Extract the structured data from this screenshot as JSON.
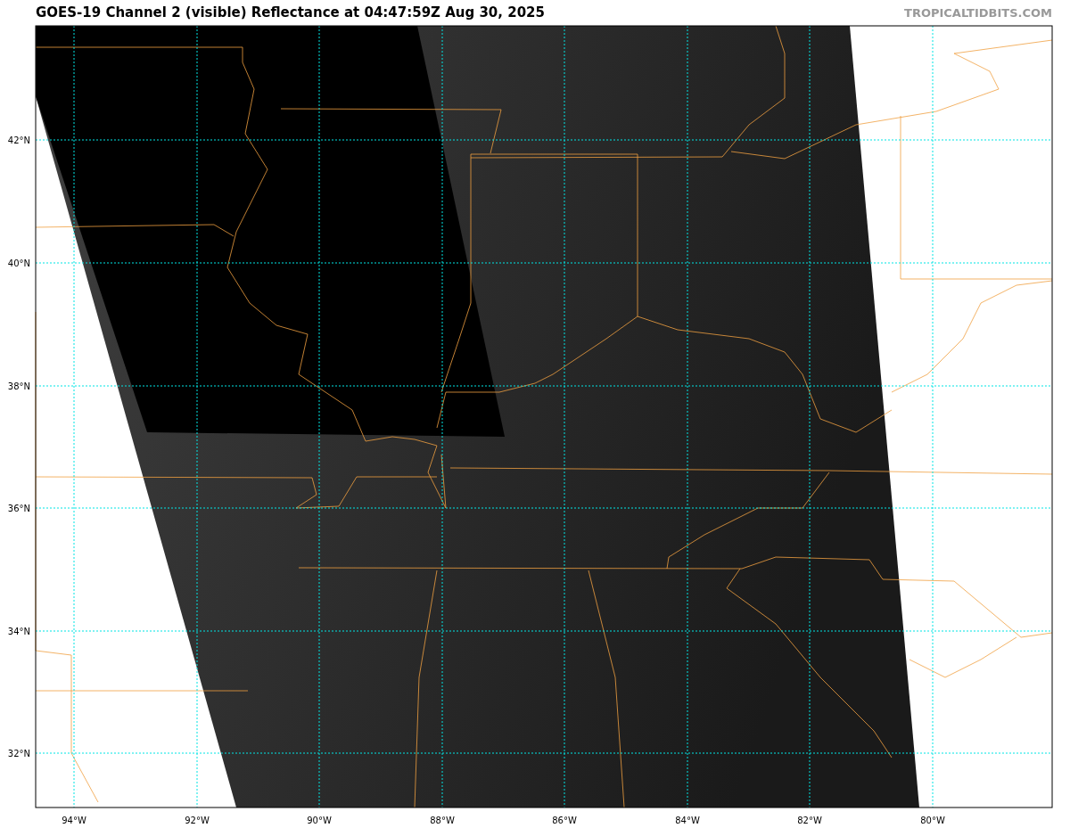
{
  "title": "GOES-19 Channel 2 (visible) Reflectance at 04:47:59Z Aug 30, 2025",
  "site": "TROPICALTIDBITS.COM",
  "lat_labels": [
    "42°N",
    "40°N",
    "38°N",
    "36°N",
    "34°N",
    "32°N"
  ],
  "lon_labels": [
    "94°W",
    "92°W",
    "90°W",
    "88°W",
    "86°W",
    "84°W",
    "82°W",
    "80°W"
  ]
}
